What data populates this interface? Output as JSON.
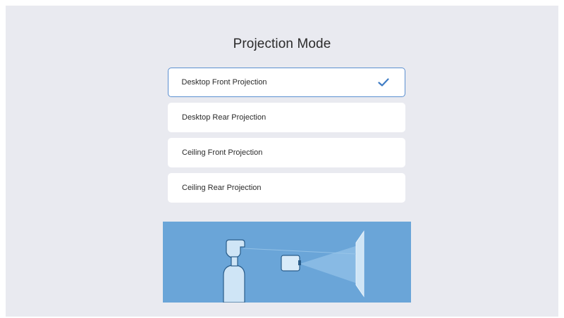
{
  "screen": {
    "title": "Projection Mode"
  },
  "options": [
    {
      "label": "Desktop Front Projection",
      "selected": true
    },
    {
      "label": "Desktop Rear Projection",
      "selected": false
    },
    {
      "label": "Ceiling Front Projection",
      "selected": false
    },
    {
      "label": "Ceiling Rear Projection",
      "selected": false
    }
  ],
  "icons": {
    "selected_indicator": "check-icon",
    "illustration": "projection-mode-illustration"
  },
  "colors": {
    "background": "#e9eaf0",
    "option_background": "#ffffff",
    "selected_border": "#5b8fd0",
    "check": "#3f7cc4",
    "illustration_background": "#6aa5d8"
  }
}
